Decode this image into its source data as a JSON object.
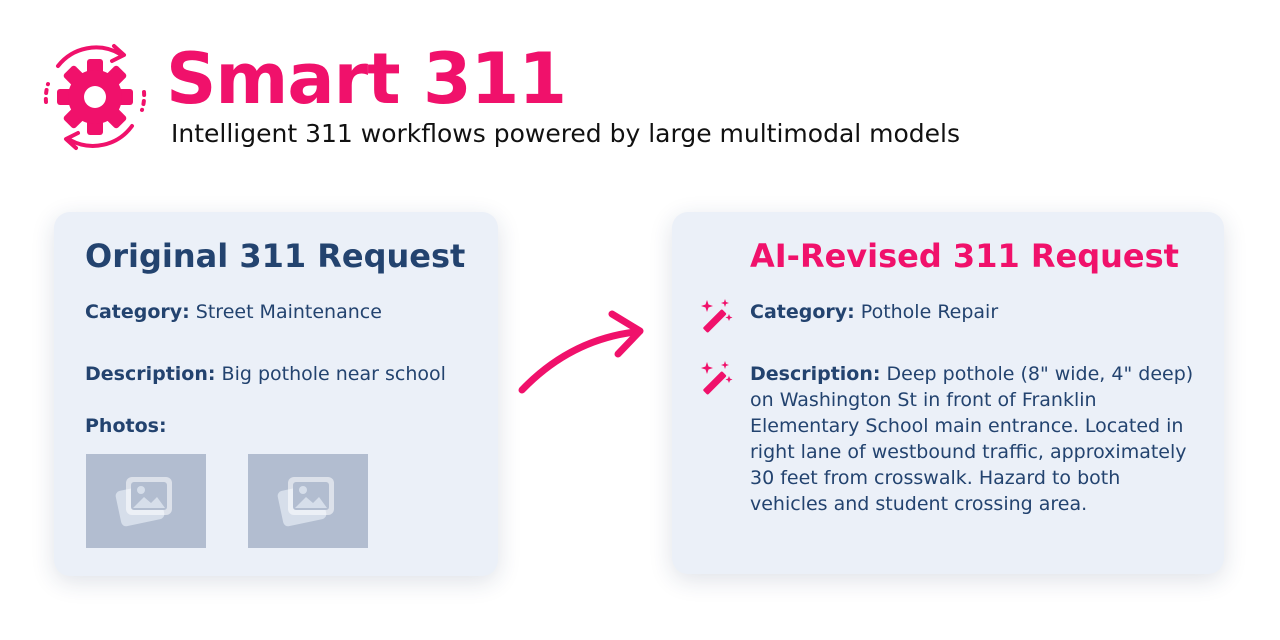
{
  "header": {
    "title": "Smart 311",
    "subtitle": "Intelligent 311 workflows powered by large multimodal models"
  },
  "original": {
    "title": "Original 311 Request",
    "category_label": "Category:",
    "category_value": " Street Maintenance",
    "description_label": "Description:",
    "description_value": " Big pothole near school",
    "photos_label": "Photos:"
  },
  "revised": {
    "title": "AI-Revised 311 Request",
    "category_label": "Category:",
    "category_value": " Pothole Repair",
    "description_label": "Description:",
    "description_value": " Deep pothole (8\" wide, 4\" deep) on Washington St in front of Franklin Elementary School main entrance. Located in right lane of westbound traffic, approximately 30 feet from crosswalk. Hazard to both vehicles and student crossing area."
  },
  "icons": {
    "logo": "gear-cycle-icon",
    "arrow": "curved-arrow-icon",
    "wand": "magic-wand-icon",
    "photo": "image-placeholder-icon"
  },
  "colors": {
    "accent": "#f0116b",
    "navy": "#23436f",
    "card_bg": "#ebf0f8",
    "photo_bg": "#b2bdd0"
  }
}
